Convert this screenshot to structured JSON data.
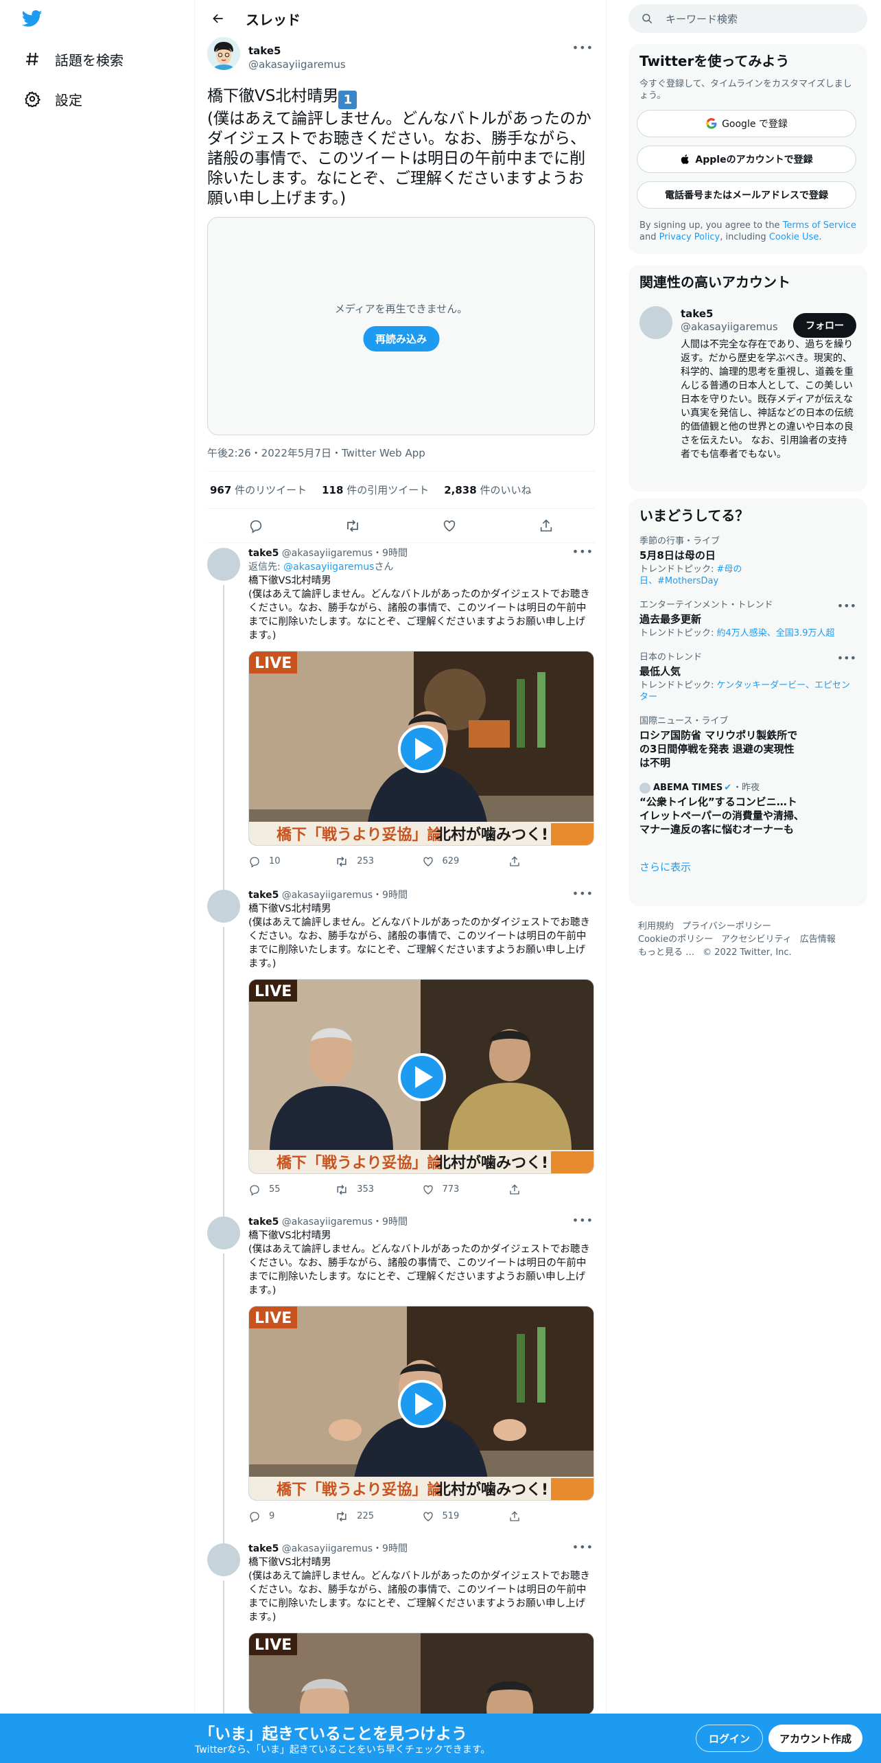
{
  "nav": {
    "explore": "話題を検索",
    "settings": "設定"
  },
  "header": {
    "title": "スレッド"
  },
  "focus_tweet": {
    "name": "take5",
    "handle": "@akasayiigaremus",
    "title": "橋下徹VS北村晴男",
    "badge": "1",
    "text": "(僕はあえて論評しません。どんなバトルがあったのかダイジェストでお聴きください。なお、勝手ながら、諸般の事情で、このツイートは明日の午前中までに削除いたします。なにとぞ、ご理解くださいますようお願い申し上げます。)",
    "media_error": "メディアを再生できません。",
    "reload": "再読み込み",
    "meta": "午後2:26・2022年5月7日・Twitter Web App",
    "retweets": "967",
    "retweets_label": "件のリツイート",
    "quotes": "118",
    "quotes_label": "件の引用ツイート",
    "likes": "2,838",
    "likes_label": "件のいいね"
  },
  "replies": [
    {
      "name": "take5",
      "handle_time": "@akasayiigaremus・9時間",
      "reply_to_prefix": "返信先: ",
      "reply_to": "@akasayiigaremus",
      "reply_to_suffix": "さん",
      "text": "橋下徹VS北村晴男\n(僕はあえて論評しません。どんなバトルがあったのかダイジェストでお聴きください。なお、勝手ながら、諸般の事情で、このツイートは明日の午前中までに削除いたします。なにとぞ、ご理解くださいますようお願い申し上げます。)",
      "thumb_live": "LIVE",
      "thumb_caption_left": "橋下「戦うより妥協」論",
      "thumb_caption_right": "北村が噛みつく!",
      "replies": "10",
      "retweets": "253",
      "likes": "629"
    },
    {
      "name": "take5",
      "handle_time": "@akasayiigaremus・9時間",
      "text": "橋下徹VS北村晴男\n(僕はあえて論評しません。どんなバトルがあったのかダイジェストでお聴きください。なお、勝手ながら、諸般の事情で、このツイートは明日の午前中までに削除いたします。なにとぞ、ご理解くださいますようお願い申し上げます。)",
      "thumb_live": "LIVE",
      "thumb_caption_left": "橋下「戦うより妥協」論",
      "thumb_caption_right": "北村が噛みつく!",
      "replies": "55",
      "retweets": "353",
      "likes": "773"
    },
    {
      "name": "take5",
      "handle_time": "@akasayiigaremus・9時間",
      "text": "橋下徹VS北村晴男\n(僕はあえて論評しません。どんなバトルがあったのかダイジェストでお聴きください。なお、勝手ながら、諸般の事情で、このツイートは明日の午前中までに削除いたします。なにとぞ、ご理解くださいますようお願い申し上げます。)",
      "thumb_live": "LIVE",
      "thumb_caption_left": "橋下「戦うより妥協」論",
      "thumb_caption_right": "北村が噛みつく!",
      "replies": "9",
      "retweets": "225",
      "likes": "519"
    },
    {
      "name": "take5",
      "handle_time": "@akasayiigaremus・9時間",
      "text": "橋下徹VS北村晴男\n(僕はあえて論評しません。どんなバトルがあったのかダイジェストでお聴きください。なお、勝手ながら、諸般の事情で、このツイートは明日の午前中までに削除いたします。なにとぞ、ご理解くださいますようお願い申し上げます。)",
      "thumb_live": "LIVE"
    }
  ],
  "search": {
    "placeholder": "キーワード検索"
  },
  "signup_panel": {
    "title": "Twitterを使ってみよう",
    "subtitle": "今すぐ登録して、タイムラインをカスタマイズしましょう。",
    "google": "Google で登録",
    "apple": "Appleのアカウントで登録",
    "phone": "電話番号またはメールアドレスで登録",
    "terms_1": "By signing up, you agree to the ",
    "terms_tos": "Terms of Service",
    "terms_2": " and ",
    "terms_privacy": "Privacy Policy",
    "terms_3": ", including ",
    "terms_cookie": "Cookie Use",
    "terms_4": "."
  },
  "relevant": {
    "title": "関連性の高いアカウント",
    "name": "take5",
    "handle": "@akasayiigaremus",
    "follow": "フォロー",
    "bio": "人間は不完全な存在であり、過ちを繰り返す。だから歴史を学ぶべき。現実的、科学的、論理的思考を重視し、道義を重んじる普通の日本人として、この美しい日本を守りたい。既存メディアが伝えない真実を発信し、神話などの日本の伝統的価値観と他の世界との違いや日本の良さを伝えたい。 なお、引用論者の支持者でも信奉者でもない。"
  },
  "trends": {
    "title": "いまどうしてる？",
    "items": [
      {
        "cat": "季節の行事・ライブ",
        "name": "5月8日は母の日",
        "sub_prefix": "トレンドトピック: ",
        "sub_links": "#母の日、#MothersDay"
      },
      {
        "cat": "エンターテインメント・トレンド",
        "name": "過去最多更新",
        "sub_prefix": "トレンドトピック: ",
        "sub_links": "約4万人感染、全国3.9万人超"
      },
      {
        "cat": "日本のトレンド",
        "name": "最低人気",
        "sub_prefix": "トレンドトピック: ",
        "sub_links": "ケンタッキーダービー、エピセンター"
      },
      {
        "cat": "国際ニュース・ライブ",
        "name": "ロシア国防省 マリウポリ製鉄所での3日間停戦を発表 退避の実現性は不明"
      },
      {
        "cat_source": "ABEMA TIMES",
        "cat_time": "・昨夜",
        "name": "“公衆トイレ化”するコンビニ…トイレットペーパーの消費量や清掃、マナー違反の客に悩むオーナーも"
      }
    ],
    "more": "さらに表示"
  },
  "footer": {
    "l1": [
      "利用規約",
      "プライバシーポリシー"
    ],
    "l2": [
      "Cookieのポリシー",
      "アクセシビリティ",
      "広告情報"
    ],
    "l3": [
      "もっと見る …",
      "© 2022 Twitter, Inc."
    ]
  },
  "bottom": {
    "headline": "「いま」起きていることを見つけよう",
    "sub": "Twitterなら、「いま」起きていることをいち早くチェックできます。",
    "login": "ログイン",
    "signup": "アカウント作成"
  },
  "colors": {
    "accent": "#1d9bf0",
    "text": "#0f1419",
    "muted": "#536471"
  }
}
